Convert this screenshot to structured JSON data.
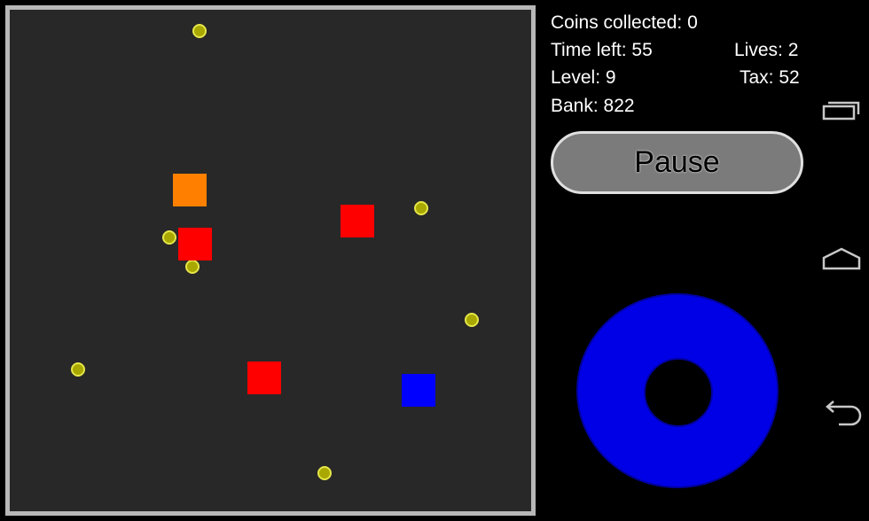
{
  "stats": {
    "coins_collected": "Coins collected: 0",
    "time_left": "Time left: 55",
    "lives": "Lives: 2",
    "level": "Level: 9",
    "tax": "Tax: 52",
    "bank": "Bank: 822"
  },
  "controls": {
    "pause_label": "Pause"
  },
  "colors": {
    "board_background": "#282828",
    "board_border": "#b7b7b7",
    "coin": "#a8a800",
    "enemy_block": "#ff0000",
    "special_block": "#ff8000",
    "player_block": "#0000ff",
    "joystick": "#0000e6",
    "pause_button": "#7b7b7b"
  },
  "navigation": {
    "icons": [
      "recent-apps-icon",
      "home-icon",
      "back-icon"
    ]
  }
}
